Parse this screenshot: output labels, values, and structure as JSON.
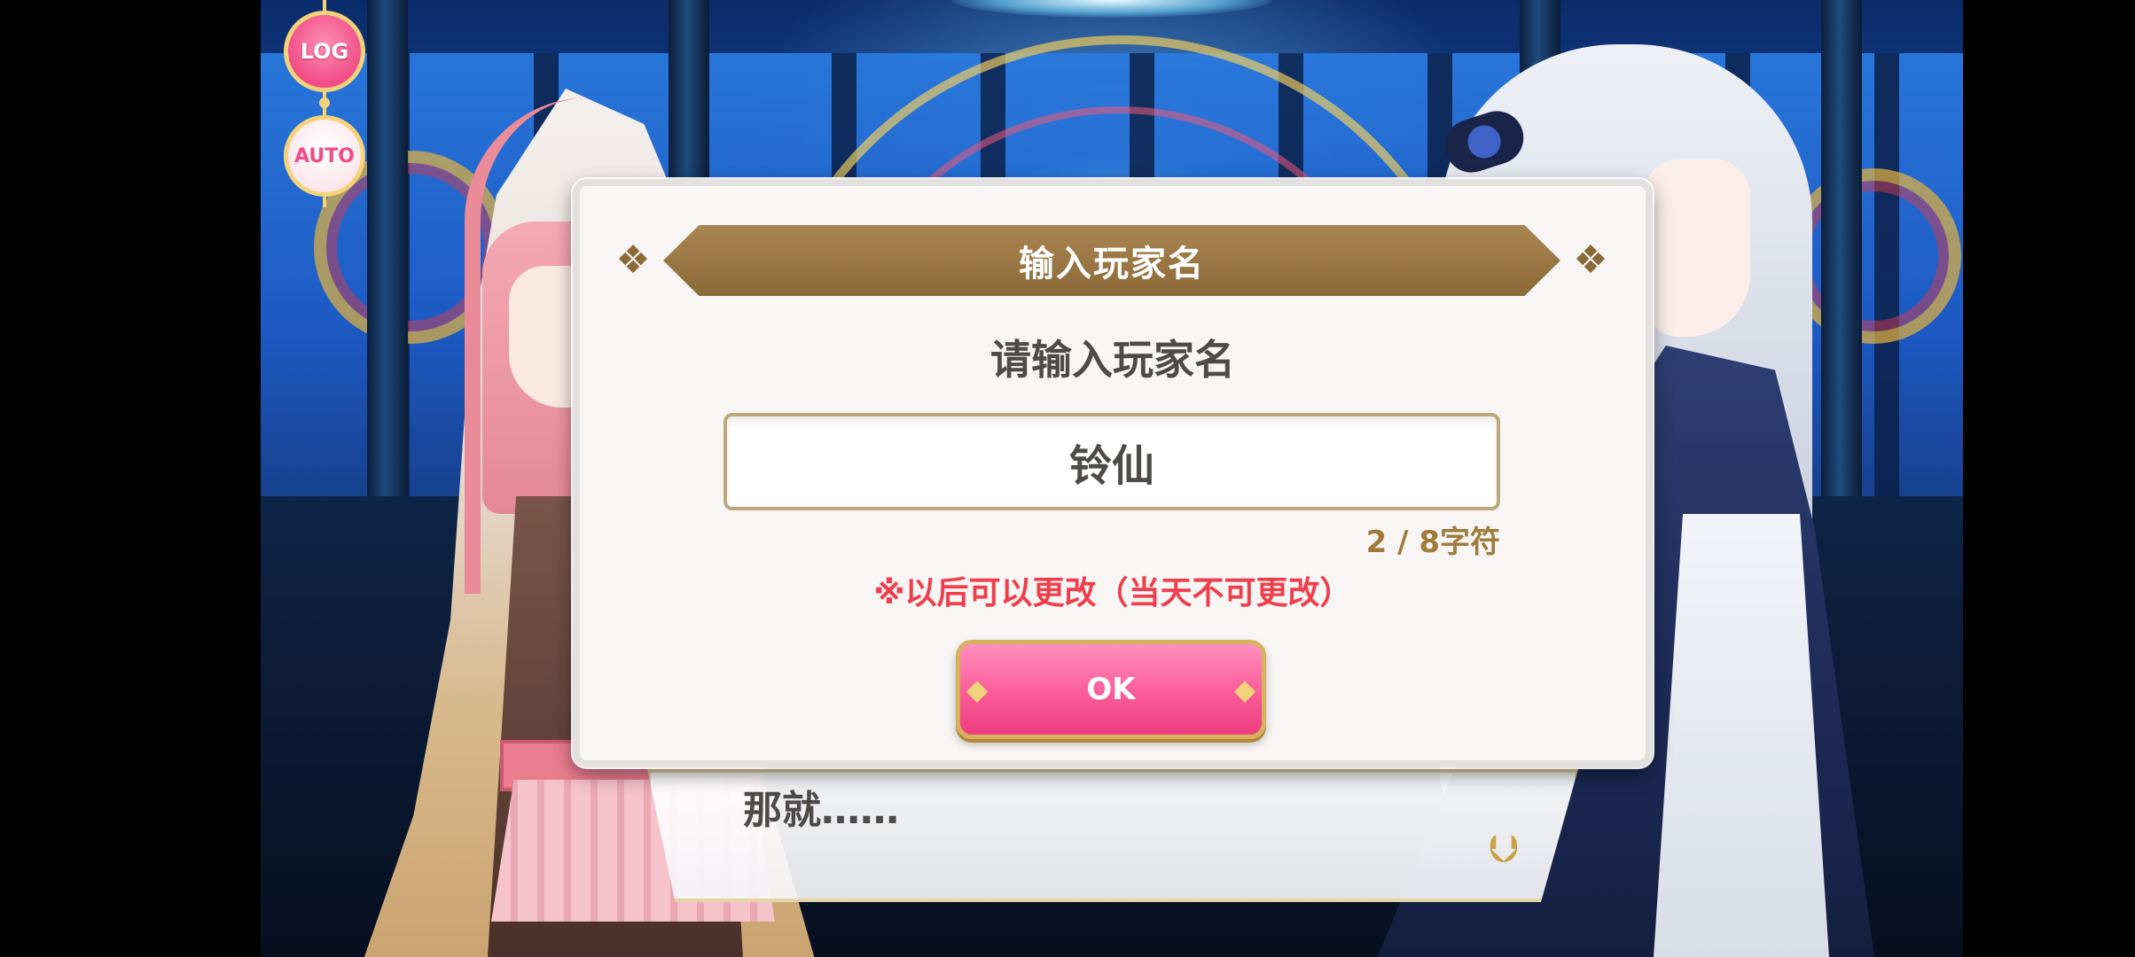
{
  "controls": {
    "log_label": "LOG",
    "auto_label": "AUTO"
  },
  "dialog": {
    "title": "输入玩家名",
    "prompt": "请输入玩家名",
    "input_value": "铃仙",
    "char_count": "2 / 8字符",
    "note": "※以后可以更改（当天不可更改）",
    "ok_label": "OK"
  },
  "textbox": {
    "line": "那就……"
  },
  "colors": {
    "banner": "#8c6a38",
    "ok_button": "#fa5c98",
    "note_text": "#ef3f4c",
    "count_text": "#a07a3d"
  },
  "icons": {
    "title_ornaments": "fleur-ornament-icon",
    "ok_gems": "gem-icon",
    "next": "next-arrow-icon"
  }
}
